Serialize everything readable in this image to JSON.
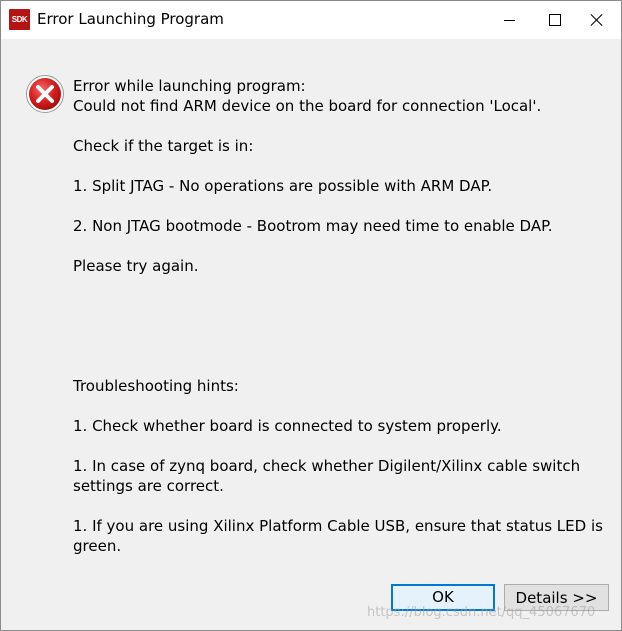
{
  "window": {
    "title": "Error Launching Program",
    "app_icon_text": "SDK"
  },
  "message": {
    "lines": [
      "Error while launching program:",
      "Could not find ARM device on the board for connection 'Local'.",
      "Check if the target is in:",
      "1. Split JTAG - No operations are possible with ARM DAP.",
      "2. Non JTAG bootmode - Bootrom may need time to enable DAP.",
      "Please try again.",
      "Troubleshooting hints:",
      "1. Check whether board is connected to system properly.",
      "1. In case of zynq board, check whether Digilent/Xilinx cable switch",
      "settings are correct.",
      "1. If you are using Xilinx Platform Cable USB, ensure that status LED is",
      "green."
    ]
  },
  "buttons": {
    "ok_label": "OK",
    "details_label": "Details >>"
  },
  "watermark": "https://blog.csdn.net/qq_45067670",
  "colors": {
    "error_red": "#d81e1e",
    "focus_blue": "#0078d7",
    "dialog_bg": "#f0f0f0"
  }
}
